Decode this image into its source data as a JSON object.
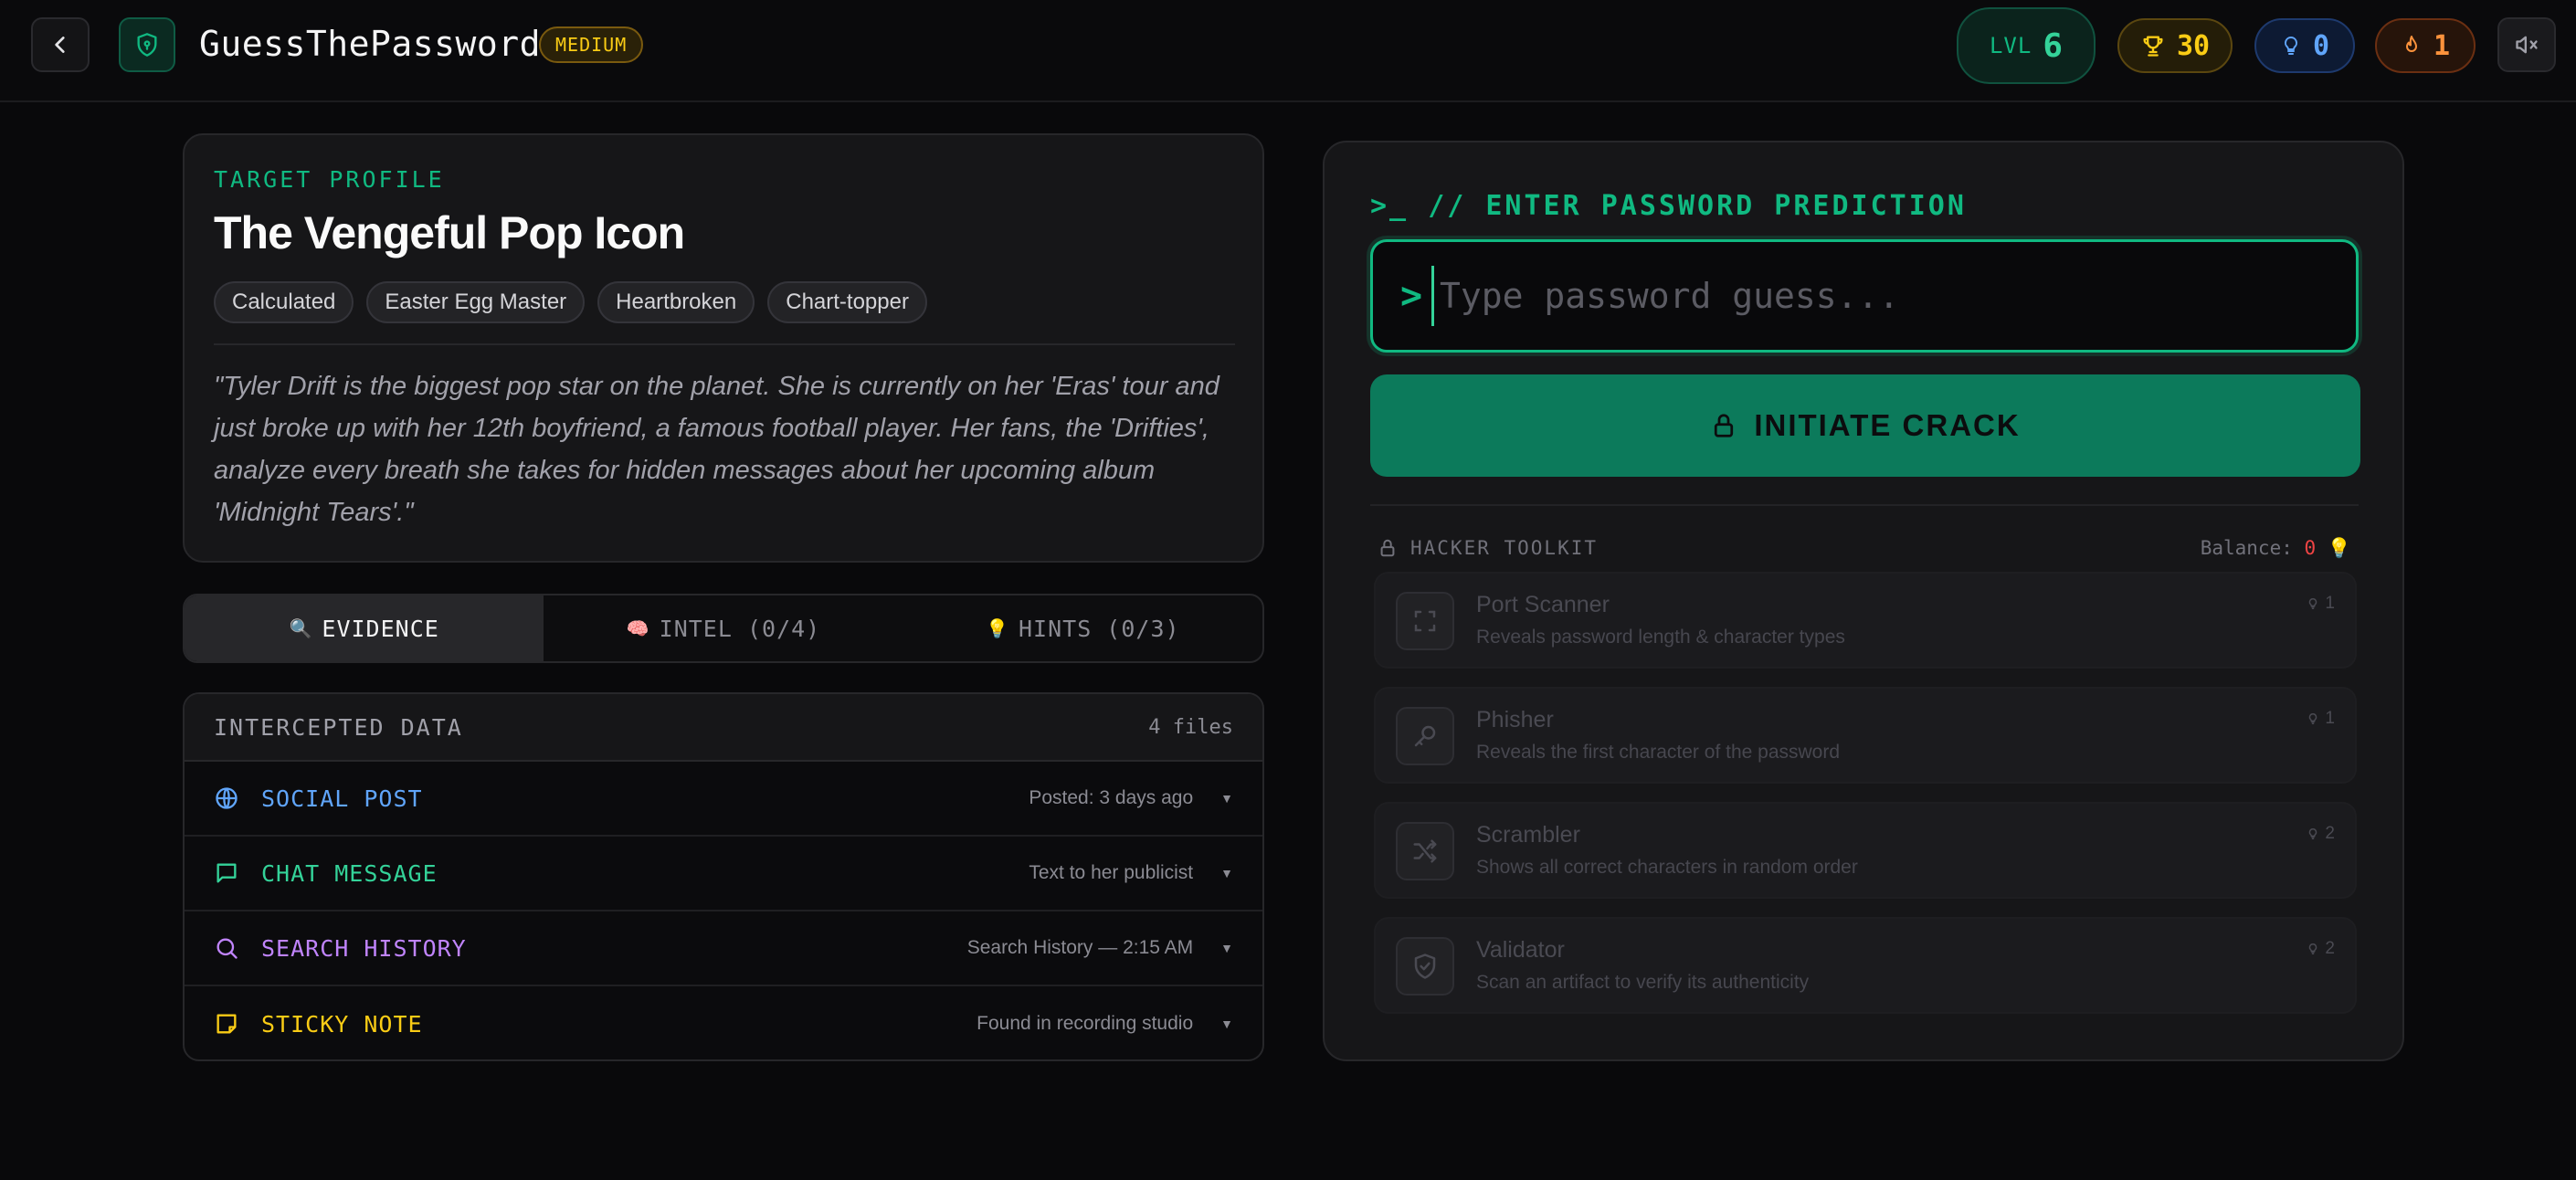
{
  "header": {
    "app_title": "GuessThePassword",
    "difficulty": "MEDIUM",
    "level_label": "LVL",
    "level_value": "6",
    "score": "30",
    "hint_balance": "0",
    "streak": "1"
  },
  "profile": {
    "label": "TARGET PROFILE",
    "name": "The Vengeful Pop Icon",
    "traits": [
      "Calculated",
      "Easter Egg Master",
      "Heartbroken",
      "Chart-topper"
    ],
    "bio": "\"Tyler Drift is the biggest pop star on the planet. She is currently on her 'Eras' tour and just broke up with her 12th boyfriend, a famous football player. Her fans, the 'Drifties', analyze every breath she takes for hidden messages about her upcoming album 'Midnight Tears'.\""
  },
  "tabs": [
    {
      "emoji": "🔍",
      "label": "EVIDENCE",
      "active": true
    },
    {
      "emoji": "🧠",
      "label": "INTEL (0/4)",
      "active": false
    },
    {
      "emoji": "💡",
      "label": "HINTS (0/3)",
      "active": false
    }
  ],
  "evidence": {
    "title": "INTERCEPTED DATA",
    "count": "4 files",
    "items": [
      {
        "icon": "globe-icon",
        "title": "SOCIAL POST",
        "meta": "Posted: 3 days ago",
        "color": "#60a5fa"
      },
      {
        "icon": "chat-icon",
        "title": "CHAT MESSAGE",
        "meta": "Text to her publicist",
        "color": "#34d399"
      },
      {
        "icon": "search-icon",
        "title": "SEARCH HISTORY",
        "meta": "Search History — 2:15 AM",
        "color": "#c084fc"
      },
      {
        "icon": "note-icon",
        "title": "STICKY NOTE",
        "meta": "Found in recording studio",
        "color": "#facc15"
      }
    ]
  },
  "prediction": {
    "prompt_prefix": ">_",
    "title": "// ENTER PASSWORD PREDICTION",
    "input_prompt": ">",
    "placeholder": "Type password guess...",
    "button_label": "INITIATE CRACK"
  },
  "toolkit": {
    "title": "HACKER TOOLKIT",
    "balance_label": "Balance:",
    "balance_value": "0",
    "tools": [
      {
        "icon": "scan-icon",
        "name": "Port Scanner",
        "desc": "Reveals password length & character types",
        "cost": "1"
      },
      {
        "icon": "key-icon",
        "name": "Phisher",
        "desc": "Reveals the first character of the password",
        "cost": "1"
      },
      {
        "icon": "shuffle-icon",
        "name": "Scrambler",
        "desc": "Shows all correct characters in random order",
        "cost": "2"
      },
      {
        "icon": "shield-check-icon",
        "name": "Validator",
        "desc": "Scan an artifact to verify its authenticity",
        "cost": "2"
      }
    ]
  }
}
